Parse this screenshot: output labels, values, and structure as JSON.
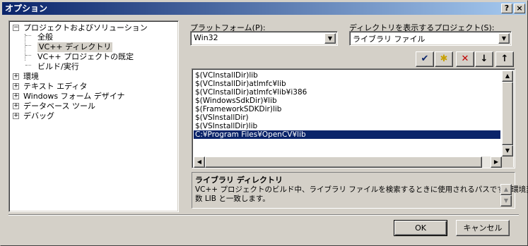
{
  "window": {
    "title": "オプション",
    "help_btn": "?",
    "close_btn": "×"
  },
  "tree": {
    "items": [
      {
        "label": "プロジェクトおよびソリューション",
        "expander": "−"
      },
      {
        "label": "全般"
      },
      {
        "label": "VC++ ディレクトリ"
      },
      {
        "label": "VC++ プロジェクトの既定"
      },
      {
        "label": "ビルド/実行"
      },
      {
        "label": "環境",
        "expander": "+"
      },
      {
        "label": "テキスト エディタ",
        "expander": "+"
      },
      {
        "label": "Windows フォーム デザイナ",
        "expander": "+"
      },
      {
        "label": "データベース ツール",
        "expander": "+"
      },
      {
        "label": "デバッグ",
        "expander": "+"
      }
    ]
  },
  "platform": {
    "label": "プラットフォーム(P):",
    "value": "Win32"
  },
  "dirs_for": {
    "label": "ディレクトリを表示するプロジェクト(S):",
    "value": "ライブラリ ファイル"
  },
  "toolbar": {
    "check_icon": "✔",
    "new_folder_icon": "✱",
    "delete_icon": "✕",
    "down_icon": "↓",
    "up_icon": "↑"
  },
  "list": {
    "rows": [
      "$(VCInstallDir)lib",
      "$(VCInstallDir)atlmfc¥lib",
      "$(VCInstallDir)atlmfc¥lib¥i386",
      "$(WindowsSdkDir)¥lib",
      "$(FrameworkSDKDir)lib",
      "$(VSInstallDir)",
      "$(VSInstallDir)lib",
      "C:¥Program Files¥OpenCV¥lib"
    ],
    "selected_index": 7
  },
  "description": {
    "title": "ライブラリ ディレクトリ",
    "line1": "VC++ プロジェクトのビルド中、ライブラリ ファイルを検索するときに使用されるパスです。環境変",
    "line2": "数 LIB と一致します。"
  },
  "buttons": {
    "ok": "OK",
    "cancel": "キャンセル"
  },
  "colors": {
    "title_start": "#0a246a",
    "title_end": "#a6caf0",
    "selection": "#0a246a",
    "face": "#d4d0c8"
  }
}
